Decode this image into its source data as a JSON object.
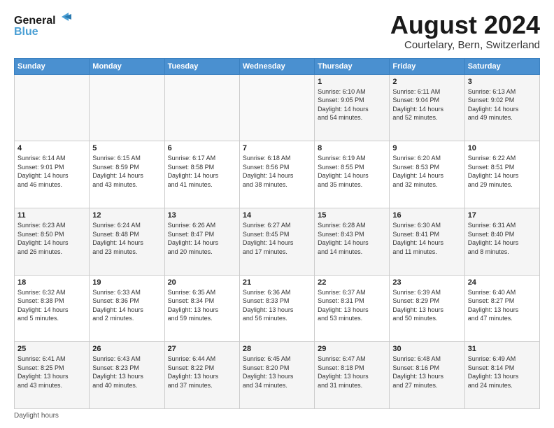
{
  "header": {
    "logo_line1": "General",
    "logo_line2": "Blue",
    "title": "August 2024",
    "subtitle": "Courtelary, Bern, Switzerland"
  },
  "calendar": {
    "days_of_week": [
      "Sunday",
      "Monday",
      "Tuesday",
      "Wednesday",
      "Thursday",
      "Friday",
      "Saturday"
    ],
    "weeks": [
      [
        {
          "num": "",
          "info": ""
        },
        {
          "num": "",
          "info": ""
        },
        {
          "num": "",
          "info": ""
        },
        {
          "num": "",
          "info": ""
        },
        {
          "num": "1",
          "info": "Sunrise: 6:10 AM\nSunset: 9:05 PM\nDaylight: 14 hours\nand 54 minutes."
        },
        {
          "num": "2",
          "info": "Sunrise: 6:11 AM\nSunset: 9:04 PM\nDaylight: 14 hours\nand 52 minutes."
        },
        {
          "num": "3",
          "info": "Sunrise: 6:13 AM\nSunset: 9:02 PM\nDaylight: 14 hours\nand 49 minutes."
        }
      ],
      [
        {
          "num": "4",
          "info": "Sunrise: 6:14 AM\nSunset: 9:01 PM\nDaylight: 14 hours\nand 46 minutes."
        },
        {
          "num": "5",
          "info": "Sunrise: 6:15 AM\nSunset: 8:59 PM\nDaylight: 14 hours\nand 43 minutes."
        },
        {
          "num": "6",
          "info": "Sunrise: 6:17 AM\nSunset: 8:58 PM\nDaylight: 14 hours\nand 41 minutes."
        },
        {
          "num": "7",
          "info": "Sunrise: 6:18 AM\nSunset: 8:56 PM\nDaylight: 14 hours\nand 38 minutes."
        },
        {
          "num": "8",
          "info": "Sunrise: 6:19 AM\nSunset: 8:55 PM\nDaylight: 14 hours\nand 35 minutes."
        },
        {
          "num": "9",
          "info": "Sunrise: 6:20 AM\nSunset: 8:53 PM\nDaylight: 14 hours\nand 32 minutes."
        },
        {
          "num": "10",
          "info": "Sunrise: 6:22 AM\nSunset: 8:51 PM\nDaylight: 14 hours\nand 29 minutes."
        }
      ],
      [
        {
          "num": "11",
          "info": "Sunrise: 6:23 AM\nSunset: 8:50 PM\nDaylight: 14 hours\nand 26 minutes."
        },
        {
          "num": "12",
          "info": "Sunrise: 6:24 AM\nSunset: 8:48 PM\nDaylight: 14 hours\nand 23 minutes."
        },
        {
          "num": "13",
          "info": "Sunrise: 6:26 AM\nSunset: 8:47 PM\nDaylight: 14 hours\nand 20 minutes."
        },
        {
          "num": "14",
          "info": "Sunrise: 6:27 AM\nSunset: 8:45 PM\nDaylight: 14 hours\nand 17 minutes."
        },
        {
          "num": "15",
          "info": "Sunrise: 6:28 AM\nSunset: 8:43 PM\nDaylight: 14 hours\nand 14 minutes."
        },
        {
          "num": "16",
          "info": "Sunrise: 6:30 AM\nSunset: 8:41 PM\nDaylight: 14 hours\nand 11 minutes."
        },
        {
          "num": "17",
          "info": "Sunrise: 6:31 AM\nSunset: 8:40 PM\nDaylight: 14 hours\nand 8 minutes."
        }
      ],
      [
        {
          "num": "18",
          "info": "Sunrise: 6:32 AM\nSunset: 8:38 PM\nDaylight: 14 hours\nand 5 minutes."
        },
        {
          "num": "19",
          "info": "Sunrise: 6:33 AM\nSunset: 8:36 PM\nDaylight: 14 hours\nand 2 minutes."
        },
        {
          "num": "20",
          "info": "Sunrise: 6:35 AM\nSunset: 8:34 PM\nDaylight: 13 hours\nand 59 minutes."
        },
        {
          "num": "21",
          "info": "Sunrise: 6:36 AM\nSunset: 8:33 PM\nDaylight: 13 hours\nand 56 minutes."
        },
        {
          "num": "22",
          "info": "Sunrise: 6:37 AM\nSunset: 8:31 PM\nDaylight: 13 hours\nand 53 minutes."
        },
        {
          "num": "23",
          "info": "Sunrise: 6:39 AM\nSunset: 8:29 PM\nDaylight: 13 hours\nand 50 minutes."
        },
        {
          "num": "24",
          "info": "Sunrise: 6:40 AM\nSunset: 8:27 PM\nDaylight: 13 hours\nand 47 minutes."
        }
      ],
      [
        {
          "num": "25",
          "info": "Sunrise: 6:41 AM\nSunset: 8:25 PM\nDaylight: 13 hours\nand 43 minutes."
        },
        {
          "num": "26",
          "info": "Sunrise: 6:43 AM\nSunset: 8:23 PM\nDaylight: 13 hours\nand 40 minutes."
        },
        {
          "num": "27",
          "info": "Sunrise: 6:44 AM\nSunset: 8:22 PM\nDaylight: 13 hours\nand 37 minutes."
        },
        {
          "num": "28",
          "info": "Sunrise: 6:45 AM\nSunset: 8:20 PM\nDaylight: 13 hours\nand 34 minutes."
        },
        {
          "num": "29",
          "info": "Sunrise: 6:47 AM\nSunset: 8:18 PM\nDaylight: 13 hours\nand 31 minutes."
        },
        {
          "num": "30",
          "info": "Sunrise: 6:48 AM\nSunset: 8:16 PM\nDaylight: 13 hours\nand 27 minutes."
        },
        {
          "num": "31",
          "info": "Sunrise: 6:49 AM\nSunset: 8:14 PM\nDaylight: 13 hours\nand 24 minutes."
        }
      ]
    ]
  },
  "footer": {
    "note": "Daylight hours"
  }
}
